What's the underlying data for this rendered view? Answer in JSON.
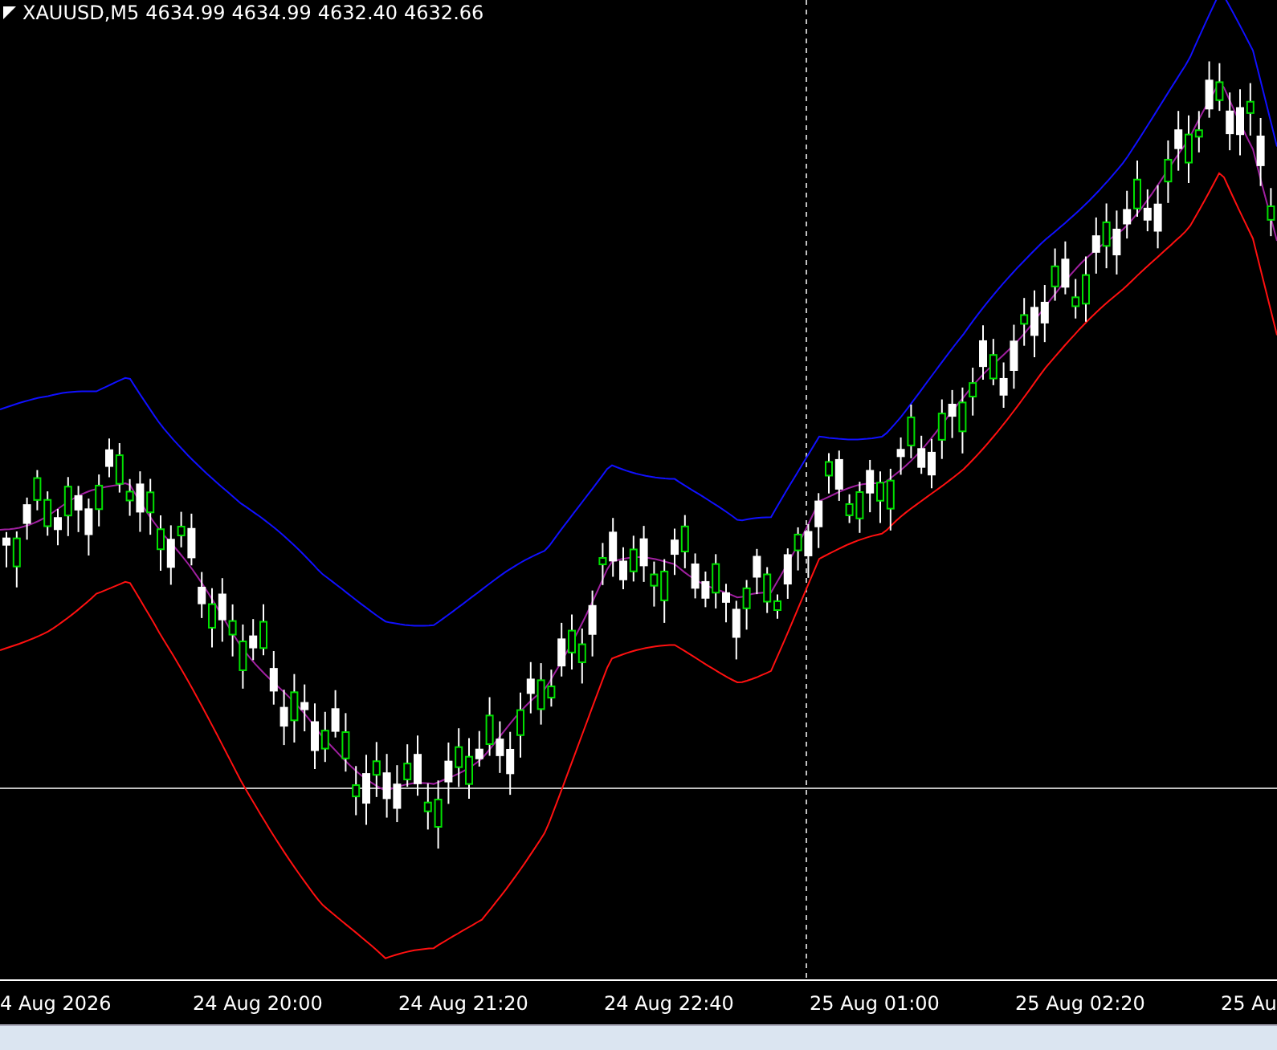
{
  "chart": {
    "symbol": "XAUUSD,M5",
    "prices": [
      "4634.99",
      "4634.99",
      "4632.40",
      "4632.66"
    ]
  },
  "time_axis": {
    "labels": [
      "4 Aug 2026",
      "24 Aug 20:00",
      "24 Aug 21:20",
      "24 Aug 22:40",
      "25 Aug 01:00",
      "25 Aug 02:20",
      "25 Au"
    ]
  }
}
